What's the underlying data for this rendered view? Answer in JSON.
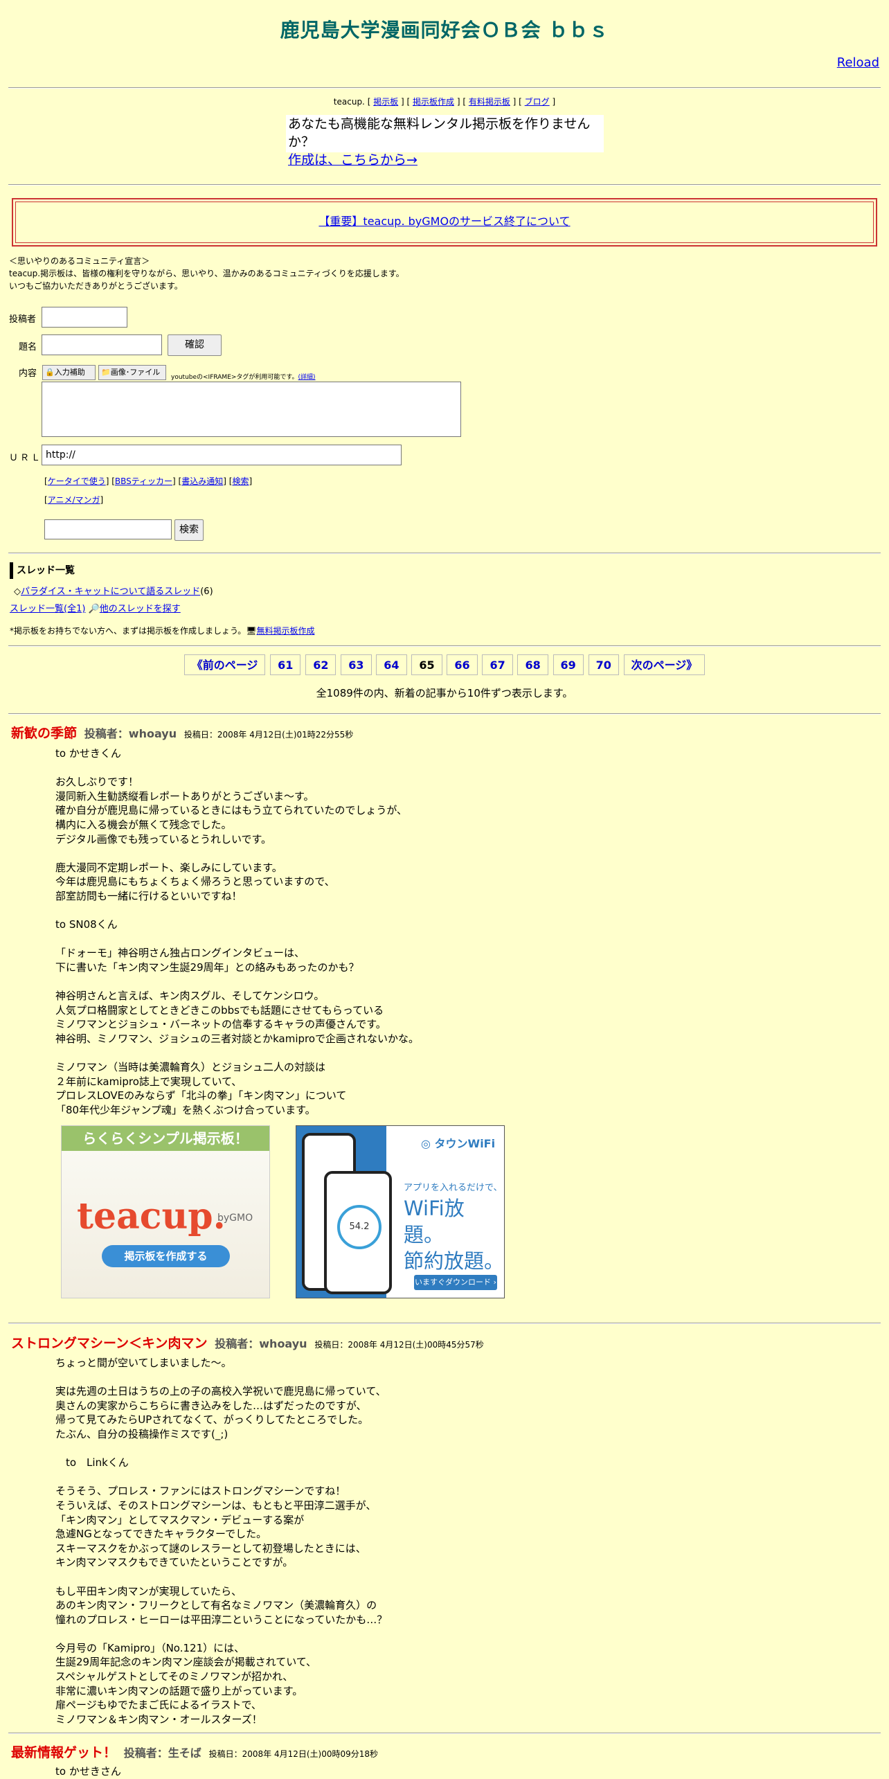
{
  "title": "鹿児島大学漫画同好会ＯＢ会 ｂｂｓ",
  "reload": "Reload",
  "topnav": {
    "brand": "teacup.",
    "links": [
      "掲示板",
      "掲示板作成",
      "有料掲示板",
      "ブログ"
    ]
  },
  "promo": {
    "line1": "あなたも高機能な無料レンタル掲示板を作りませんか？",
    "link": "作成は、こちらから→"
  },
  "notice": "【重要】teacup. byGMOのサービス終了について",
  "declaration": [
    "＜思いやりのあるコミュニティ宣言＞",
    "teacup.掲示板は、皆様の権利を守りながら、思いやり、温かみのあるコミュニティづくりを応援します。",
    "いつもご協力いただきありがとうございます。"
  ],
  "form": {
    "author_label": "投稿者",
    "subject_label": "題名",
    "confirm": "確認",
    "content_label": "内容",
    "assist": "入力補助",
    "image": "画像･ファイル",
    "youtube_note": "youtubeの<IFRAME>タグが利用可能です。",
    "details": "(詳細)",
    "url_label": "ＵＲＬ",
    "url_value": "http://",
    "links1": [
      "ケータイで使う",
      "BBSティッカー",
      "書込み通知",
      "検索"
    ],
    "links2": [
      "アニメ/マンガ"
    ],
    "search": "検索"
  },
  "threads": {
    "heading": "スレッド一覧",
    "item": "パラダイス・キャットについて語るスレッド",
    "item_count": "(6)",
    "all": "スレッド一覧(全1)",
    "other": "他のスレッドを探す",
    "note": "*掲示板をお持ちでない方へ、まずは掲示板を作成しましょう。",
    "create": "無料掲示板作成"
  },
  "pager": {
    "prev": "《前のページ",
    "pages": [
      "61",
      "62",
      "63",
      "64",
      "65",
      "66",
      "67",
      "68",
      "69",
      "70"
    ],
    "current": "65",
    "next": "次のページ》"
  },
  "total": "全1089件の内、新着の記事から10件ずつ表示します。",
  "posts": [
    {
      "title": "新歓の季節",
      "author": "投稿者：whoayu",
      "date": "投稿日：2008年 4月12日(土)01時22分55秒",
      "body": "to かせきくん\n\nお久しぶりです！\n漫同新入生勧誘縦看レポートありがとうございま～す。\n確か自分が鹿児島に帰っているときにはもう立てられていたのでしょうが、\n構内に入る機会が無くて残念でした。\nデジタル画像でも残っているとうれしいです。\n\n鹿大漫同不定期レポート、楽しみにしています。\n今年は鹿児島にもちょくちょく帰ろうと思っていますので、\n部室訪問も一緒に行けるといいですね！\n\nto SN08くん\n\n「ドォーモ」神谷明さん独占ロングインタビューは、\n下に書いた「キン肉マン生誕29周年」との絡みもあったのかも？\n\n神谷明さんと言えば、キン肉スグル、そしてケンシロウ。\n人気プロ格闘家としてときどきこのbbsでも話題にさせてもらっている\nミノワマンとジョシュ・バーネットの信奉するキャラの声優さんです。\n神谷明、ミノワマン、ジョシュの三者対談とかkamiproで企画されないかな。\n\nミノワマン（当時は美濃輪育久）とジョシュ二人の対談は\n２年前にkamipro誌上で実現していて、\nプロレスLOVEのみならず「北斗の拳」「キン肉マン」について\n「80年代少年ジャンプ魂」を熱くぶつけ合っています。"
    },
    {
      "title": "ストロングマシーン＜キン肉マン",
      "author": "投稿者：whoayu",
      "date": "投稿日：2008年 4月12日(土)00時45分57秒",
      "body": "ちょっと間が空いてしまいました～。\n\n実は先週の土日はうちの上の子の高校入学祝いで鹿児島に帰っていて、\n奥さんの実家からこちらに書き込みをした…はずだったのですが、\n帰って見てみたらUPされてなくて、がっくりしてたところでした。\nたぶん、自分の投稿操作ミスです(_;)\n\n　to　Linkくん\n\nそうそう、プロレス・ファンにはストロングマシーンですね！\nそういえば、そのストロングマシーンは、もともと平田淳二選手が、\n「キン肉マン」としてマスクマン・デビューする案が\n急遽NGとなってできたキャラクターでした。\nスキーマスクをかぶって謎のレスラーとして初登場したときには、\nキン肉マンマスクもできていたということですが。\n\nもし平田キン肉マンが実現していたら、\nあのキン肉マン・フリークとして有名なミノワマン（美濃輪育久）の\n憧れのプロレス・ヒーローは平田淳二ということになっていたかも…？\n\n今月号の「Kamipro」（No.121）には、\n生誕29周年記念のキン肉マン座談会が掲載されていて、\nスペシャルゲストとしてそのミノワマンが招かれ、\n非常に濃いキン肉マンの話題で盛り上がっています。\n扉ページもゆでたまご氏によるイラストで、\nミノワマン＆キン肉マン・オールスターズ！"
    },
    {
      "title": "最新情報ゲット！",
      "author": "投稿者：生そば",
      "date": "投稿日：2008年 4月12日(土)00時09分18秒",
      "body": "to かせきさん"
    }
  ],
  "ads": {
    "teacup": {
      "banner": "らくらくシンプル掲示板！",
      "logo": "teacup.",
      "by": "byGMO",
      "cta": "掲示板を作成する"
    },
    "wifi": {
      "brand": "タウンWiFi",
      "line1": "アプリを入れるだけで、",
      "line2": "WiFi放題。",
      "line3": "節約放題。",
      "download": "いますぐダウンロード ›",
      "screen": "54.2"
    }
  }
}
